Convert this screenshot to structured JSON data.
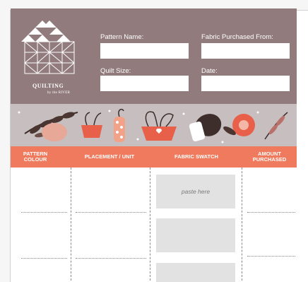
{
  "brand": {
    "name_main": "QUILTING",
    "name_sub": "by the RIVER"
  },
  "fields": {
    "pattern_name": "Pattern Name:",
    "fabric_purchased_from": "Fabric Purchased From:",
    "quilt_size": "Quilt Size:",
    "date": "Date:"
  },
  "table": {
    "headers": [
      "PATTERN\nCOLOUR",
      "PLACEMENT / UNIT",
      "FABRIC SWATCH",
      "AMOUNT\nPURCHASED"
    ],
    "paste_label": "paste here"
  },
  "colors": {
    "header_bg": "#917b7d",
    "banner_bg": "#c7bfbf",
    "table_header_bg": "#ef7a5d",
    "swatch_bg": "#e3e2e3"
  }
}
